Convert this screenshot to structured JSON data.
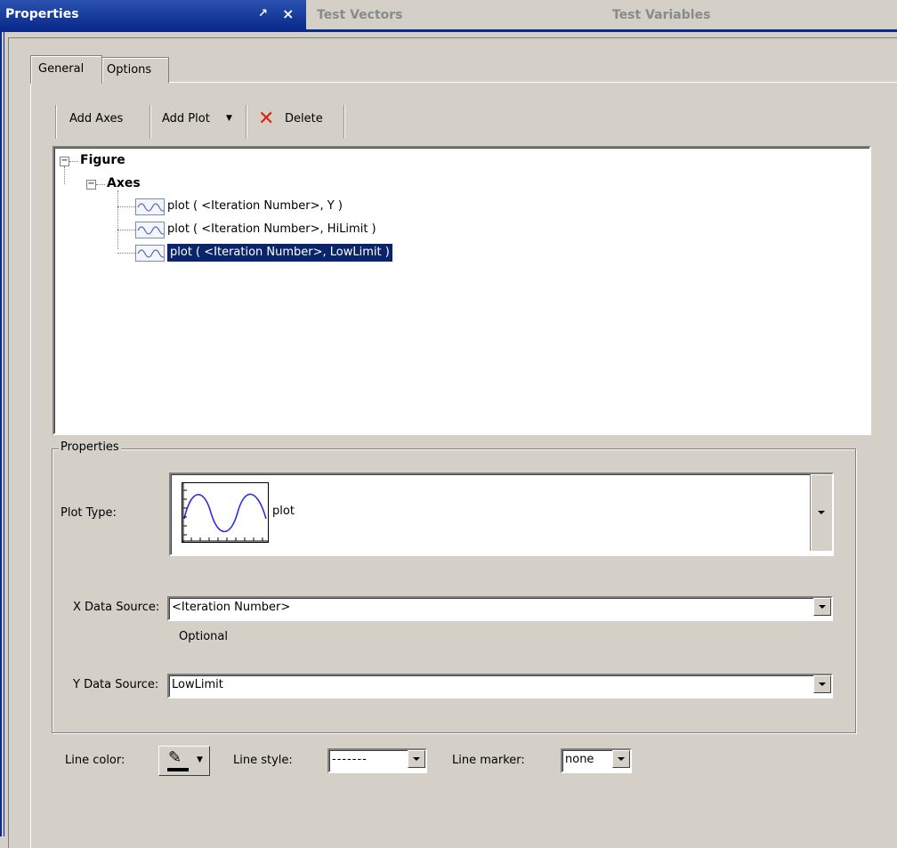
{
  "dock_tabs": {
    "active": "Properties",
    "inactive": [
      "Test Vectors",
      "Test Variables"
    ]
  },
  "sub_tabs": [
    "General",
    "Options"
  ],
  "toolbar": {
    "add_axes": "Add Axes",
    "add_plot": "Add Plot",
    "delete": "Delete"
  },
  "tree": {
    "figure": "Figure",
    "axes": "Axes",
    "plots": [
      "plot ( <Iteration Number>, Y )",
      "plot ( <Iteration Number>, HiLimit )",
      "plot ( <Iteration Number>, LowLimit )"
    ],
    "selected_index": 2
  },
  "properties": {
    "group_title": "Properties",
    "plot_type_label": "Plot Type:",
    "plot_type_value": "plot",
    "x_label": "X Data Source:",
    "x_value": "<Iteration Number>",
    "x_hint": "Optional",
    "y_label": "Y Data Source:",
    "y_value": "LowLimit",
    "line_color_label": "Line color:",
    "line_style_label": "Line style:",
    "line_style_value": "-------",
    "line_marker_label": "Line marker:",
    "line_marker_value": "none"
  },
  "colors": {
    "active_tab": "#0a2a8c",
    "selection": "#0a246a",
    "delete_icon": "#e02010",
    "plot_wave": "#2a2aff",
    "window_bg": "#d4d0c8"
  }
}
